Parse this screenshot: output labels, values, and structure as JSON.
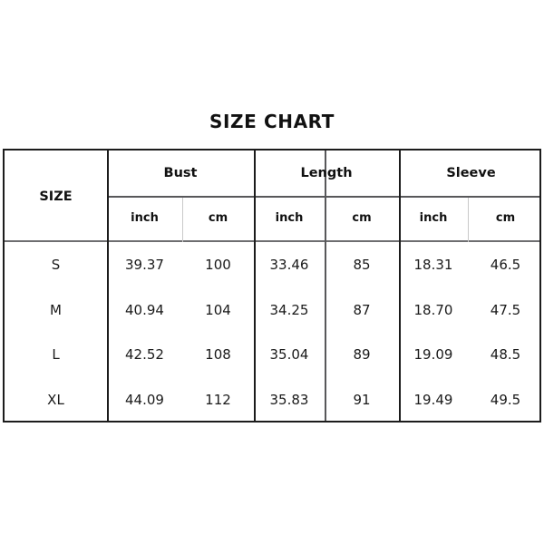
{
  "title": "SIZE CHART",
  "table": {
    "size_header": "SIZE",
    "groups": [
      {
        "label": "Bust",
        "units": [
          "inch",
          "cm"
        ]
      },
      {
        "label": "Length",
        "units": [
          "inch",
          "cm"
        ]
      },
      {
        "label": "Sleeve",
        "units": [
          "inch",
          "cm"
        ]
      }
    ],
    "rows": [
      {
        "size": "S",
        "values": [
          "39.37",
          "100",
          "33.46",
          "85",
          "18.31",
          "46.5"
        ]
      },
      {
        "size": "M",
        "values": [
          "40.94",
          "104",
          "34.25",
          "87",
          "18.70",
          "47.5"
        ]
      },
      {
        "size": "L",
        "values": [
          "42.52",
          "108",
          "35.04",
          "89",
          "19.09",
          "48.5"
        ]
      },
      {
        "size": "XL",
        "values": [
          "44.09",
          "112",
          "35.83",
          "91",
          "19.49",
          "49.5"
        ]
      }
    ]
  },
  "chart_data": {
    "type": "table",
    "title": "SIZE CHART",
    "columns": [
      "SIZE",
      "Bust inch",
      "Bust cm",
      "Length inch",
      "Length cm",
      "Sleeve inch",
      "Sleeve cm"
    ],
    "column_groups": [
      "SIZE",
      "Bust",
      "Length",
      "Sleeve"
    ],
    "units": [
      "",
      "inch",
      "cm",
      "inch",
      "cm",
      "inch",
      "cm"
    ],
    "categories": [
      "S",
      "M",
      "L",
      "XL"
    ],
    "series": [
      {
        "name": "Bust inch",
        "values": [
          39.37,
          40.94,
          42.52,
          44.09
        ]
      },
      {
        "name": "Bust cm",
        "values": [
          100,
          104,
          108,
          112
        ]
      },
      {
        "name": "Length inch",
        "values": [
          33.46,
          34.25,
          35.04,
          35.83
        ]
      },
      {
        "name": "Length cm",
        "values": [
          85,
          87,
          89,
          91
        ]
      },
      {
        "name": "Sleeve inch",
        "values": [
          18.31,
          18.7,
          19.09,
          19.49
        ]
      },
      {
        "name": "Sleeve cm",
        "values": [
          46.5,
          47.5,
          48.5,
          49.5
        ]
      }
    ],
    "rows": [
      [
        "S",
        "39.37",
        "100",
        "33.46",
        "85",
        "18.31",
        "46.5"
      ],
      [
        "M",
        "40.94",
        "104",
        "34.25",
        "87",
        "18.70",
        "47.5"
      ],
      [
        "L",
        "42.52",
        "108",
        "35.04",
        "89",
        "19.09",
        "48.5"
      ],
      [
        "XL",
        "44.09",
        "112",
        "35.83",
        "91",
        "19.49",
        "49.5"
      ]
    ],
    "grid": true,
    "legend": "none"
  }
}
